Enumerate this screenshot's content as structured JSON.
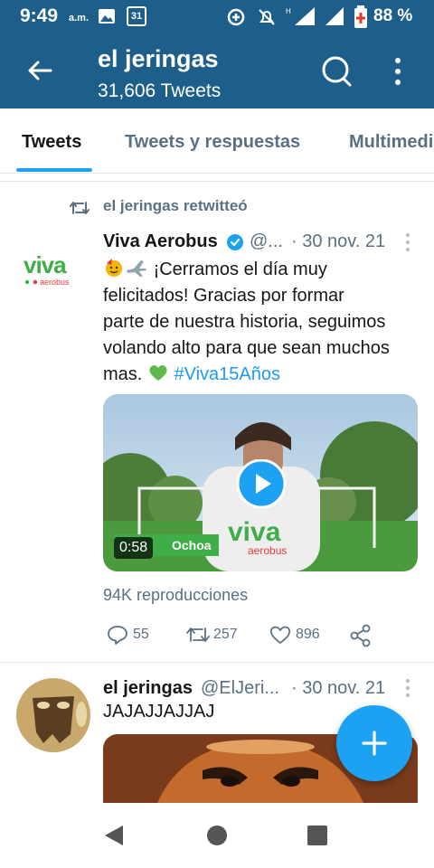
{
  "status_bar": {
    "time": "9:49",
    "ampm": "a.m.",
    "calendar_day": "31",
    "battery_percent": "88 %"
  },
  "header": {
    "title": "el jeringas",
    "subtitle": "31,606 Tweets"
  },
  "tabs": [
    {
      "label": "Tweets",
      "active": true
    },
    {
      "label": "Tweets y respuestas",
      "active": false
    },
    {
      "label": "Multimedia",
      "active": false
    }
  ],
  "tweets": [
    {
      "retweet_label": "el jeringas retwitteó",
      "name": "Viva Aerobus",
      "handle": "@...",
      "date": "· 30 nov. 21",
      "text_lines": [
        "¡Cerramos el día muy",
        "felicitados! Gracias por formar",
        "parte de nuestra historia, seguimos",
        "volando alto para que sean muchos"
      ],
      "last_line_prefix": "mas.",
      "hashtag": "#Viva15Años",
      "video_duration": "0:58",
      "video_caption": "Ochoa",
      "views": "94K reproducciones",
      "replies": "55",
      "retweets": "257",
      "likes": "896"
    },
    {
      "name": "el jeringas",
      "handle": "@ElJeri...",
      "date": "· 30 nov. 21",
      "text": "JAJAJJAJJAJ"
    }
  ],
  "colors": {
    "header_blue": "#1d5f8a",
    "twitter_blue": "#1da1f2",
    "viva_green": "#3fae49",
    "muted_text": "#5b7083"
  }
}
